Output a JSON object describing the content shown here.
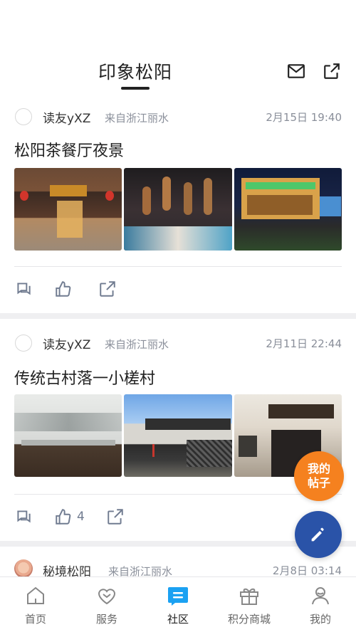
{
  "header": {
    "title": "印象松阳",
    "icons": [
      "mail-icon",
      "share-icon"
    ]
  },
  "posts": [
    {
      "user": "读友yXZ",
      "from": "来自浙江丽水",
      "time": "2月15日 19:40",
      "title": "松阳茶餐厅夜景",
      "likes": ""
    },
    {
      "user": "读友yXZ",
      "from": "来自浙江丽水",
      "time": "2月11日 22:44",
      "title": "传统古村落一小槎村",
      "likes": "4"
    },
    {
      "user": "秘境松阳",
      "from": "来自浙江丽水",
      "time": "2月8日 03:14"
    }
  ],
  "fab": {
    "my_posts_line1": "我的",
    "my_posts_line2": "帖子"
  },
  "nav": {
    "items": [
      {
        "label": "首页",
        "icon": "home-icon"
      },
      {
        "label": "服务",
        "icon": "heart-icon"
      },
      {
        "label": "社区",
        "icon": "chat-icon",
        "active": true
      },
      {
        "label": "积分商城",
        "icon": "gift-icon"
      },
      {
        "label": "我的",
        "icon": "user-icon"
      }
    ]
  },
  "colors": {
    "accent": "#2a53a8",
    "nav_active": "#1ba1f2",
    "fab_orange": "#f5811f",
    "muted": "#8a8f9a"
  }
}
